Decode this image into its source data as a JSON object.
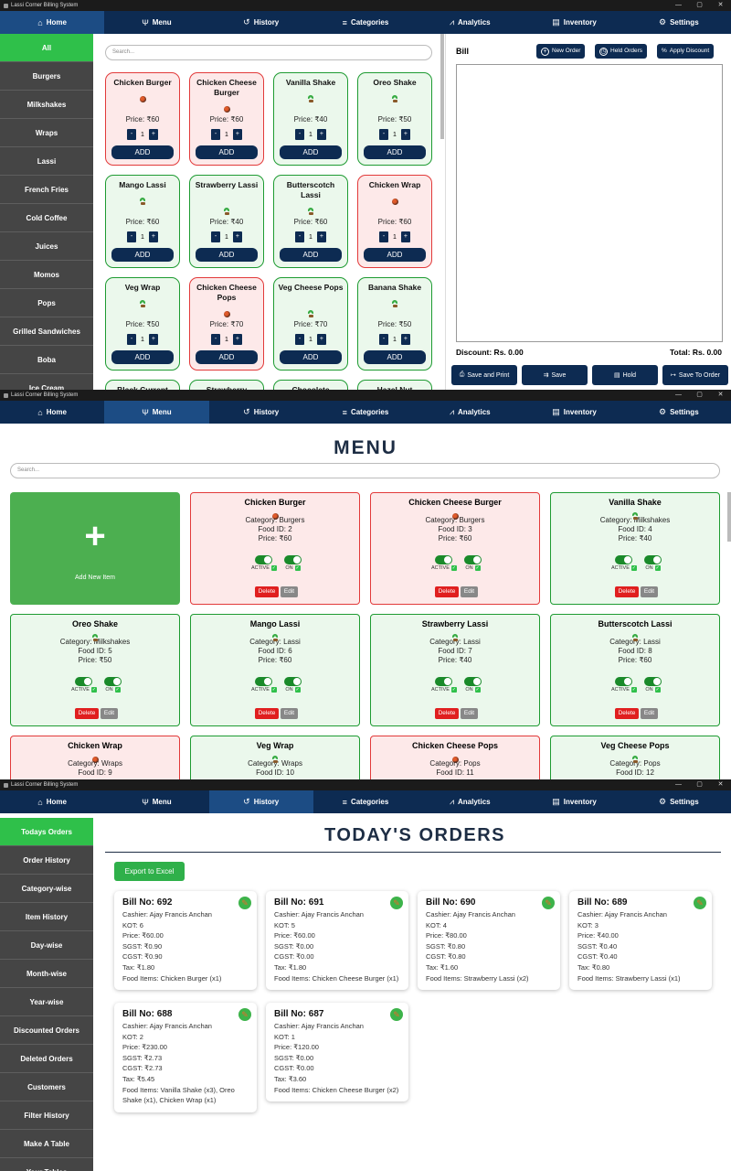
{
  "app_title": "Lassi Corner Billing System",
  "window_controls": [
    "—",
    "▢",
    "✕"
  ],
  "nav": [
    {
      "label": "Home",
      "icon": "home-icon"
    },
    {
      "label": "Menu",
      "icon": "cutlery-icon"
    },
    {
      "label": "History",
      "icon": "history-icon"
    },
    {
      "label": "Categories",
      "icon": "list-icon"
    },
    {
      "label": "Analytics",
      "icon": "chart-icon"
    },
    {
      "label": "Inventory",
      "icon": "inventory-icon"
    },
    {
      "label": "Settings",
      "icon": "gear-icon"
    }
  ],
  "home": {
    "categories": [
      "All",
      "Burgers",
      "Milkshakes",
      "Wraps",
      "Lassi",
      "French Fries",
      "Cold Coffee",
      "Juices",
      "Momos",
      "Pops",
      "Grilled Sandwiches",
      "Boba",
      "Ice Cream"
    ],
    "search_placeholder": "Search...",
    "products": [
      {
        "name": "Chicken Burger",
        "price": "Price: ₹60",
        "veg": false
      },
      {
        "name": "Chicken Cheese Burger",
        "price": "Price: ₹60",
        "veg": false
      },
      {
        "name": "Vanilla Shake",
        "price": "Price: ₹40",
        "veg": true
      },
      {
        "name": "Oreo Shake",
        "price": "Price: ₹50",
        "veg": true
      },
      {
        "name": "Mango Lassi",
        "price": "Price: ₹60",
        "veg": true
      },
      {
        "name": "Strawberry Lassi",
        "price": "Price: ₹40",
        "veg": true
      },
      {
        "name": "Butterscotch Lassi",
        "price": "Price: ₹60",
        "veg": true
      },
      {
        "name": "Chicken Wrap",
        "price": "Price: ₹60",
        "veg": false
      },
      {
        "name": "Veg Wrap",
        "price": "Price: ₹50",
        "veg": true
      },
      {
        "name": "Chicken Cheese Pops",
        "price": "Price: ₹70",
        "veg": false
      },
      {
        "name": "Veg Cheese Pops",
        "price": "Price: ₹70",
        "veg": true
      },
      {
        "name": "Banana Shake",
        "price": "Price: ₹50",
        "veg": true
      }
    ],
    "partial_products": [
      {
        "name": "Black Current",
        "veg": true
      },
      {
        "name": "Strawberry",
        "veg": true
      },
      {
        "name": "Chocolate",
        "veg": true
      },
      {
        "name": "Hazel Nut",
        "veg": true
      }
    ],
    "qty_default": "1",
    "qty_minus": "-",
    "qty_plus": "+",
    "add_label": "ADD",
    "bill": {
      "title": "Bill",
      "new_order": "New Order",
      "held_orders": "Held Orders",
      "apply_discount": "Apply Discount",
      "discount": "Discount: Rs. 0.00",
      "total": "Total: Rs. 0.00",
      "save_print": "Save and Print",
      "save": "Save",
      "hold": "Hold",
      "save_to_order": "Save To Order"
    }
  },
  "menu": {
    "title": "MENU",
    "search_placeholder": "Search...",
    "add_new_label": "Add New Item",
    "add_new_symbol": "+",
    "active_label": "ACTIVE",
    "on_label": "ON",
    "delete_label": "Delete",
    "edit_label": "Edit",
    "items": [
      {
        "name": "Chicken Burger",
        "category": "Category: Burgers",
        "food_id": "Food ID: 2",
        "price": "Price: ₹60",
        "veg": false
      },
      {
        "name": "Chicken Cheese Burger",
        "category": "Category: Burgers",
        "food_id": "Food ID: 3",
        "price": "Price: ₹60",
        "veg": false
      },
      {
        "name": "Vanilla Shake",
        "category": "Category: Milkshakes",
        "food_id": "Food ID: 4",
        "price": "Price: ₹40",
        "veg": true
      },
      {
        "name": "Oreo Shake",
        "category": "Category: Milkshakes",
        "food_id": "Food ID: 5",
        "price": "Price: ₹50",
        "veg": true
      },
      {
        "name": "Mango Lassi",
        "category": "Category: Lassi",
        "food_id": "Food ID: 6",
        "price": "Price: ₹60",
        "veg": true
      },
      {
        "name": "Strawberry Lassi",
        "category": "Category: Lassi",
        "food_id": "Food ID: 7",
        "price": "Price: ₹40",
        "veg": true
      },
      {
        "name": "Butterscotch Lassi",
        "category": "Category: Lassi",
        "food_id": "Food ID: 8",
        "price": "Price: ₹60",
        "veg": true
      },
      {
        "name": "Chicken Wrap",
        "category": "Category: Wraps",
        "food_id": "Food ID: 9",
        "price": "",
        "veg": false
      },
      {
        "name": "Veg Wrap",
        "category": "Category: Wraps",
        "food_id": "Food ID: 10",
        "price": "",
        "veg": true
      },
      {
        "name": "Chicken Cheese Pops",
        "category": "Category: Pops",
        "food_id": "Food ID: 11",
        "price": "",
        "veg": false
      },
      {
        "name": "Veg Cheese Pops",
        "category": "Category: Pops",
        "food_id": "Food ID: 12",
        "price": "",
        "veg": true
      }
    ]
  },
  "history": {
    "sidebar": [
      "Todays Orders",
      "Order History",
      "Category-wise",
      "Item History",
      "Day-wise",
      "Month-wise",
      "Year-wise",
      "Discounted Orders",
      "Deleted Orders",
      "Customers",
      "Filter History",
      "Make A Table",
      "Your Tables"
    ],
    "title": "TODAY'S ORDERS",
    "export_label": "Export to Excel",
    "orders": [
      {
        "bill": "Bill No: 692",
        "cashier": "Cashier: Ajay Francis Anchan",
        "kot": "KOT: 6",
        "price": "Price: ₹60.00",
        "sgst": "SGST: ₹0.90",
        "cgst": "CGST: ₹0.90",
        "tax": "Tax: ₹1.80",
        "items": "Food Items: Chicken Burger (x1)"
      },
      {
        "bill": "Bill No: 691",
        "cashier": "Cashier: Ajay Francis Anchan",
        "kot": "KOT: 5",
        "price": "Price: ₹60.00",
        "sgst": "SGST: ₹0.00",
        "cgst": "CGST: ₹0.00",
        "tax": "Tax: ₹1.80",
        "items": "Food Items: Chicken Cheese Burger (x1)"
      },
      {
        "bill": "Bill No: 690",
        "cashier": "Cashier: Ajay Francis Anchan",
        "kot": "KOT: 4",
        "price": "Price: ₹80.00",
        "sgst": "SGST: ₹0.80",
        "cgst": "CGST: ₹0.80",
        "tax": "Tax: ₹1.60",
        "items": "Food Items: Strawberry Lassi (x2)"
      },
      {
        "bill": "Bill No: 689",
        "cashier": "Cashier: Ajay Francis Anchan",
        "kot": "KOT: 3",
        "price": "Price: ₹40.00",
        "sgst": "SGST: ₹0.40",
        "cgst": "CGST: ₹0.40",
        "tax": "Tax: ₹0.80",
        "items": "Food Items: Strawberry Lassi (x1)"
      },
      {
        "bill": "Bill No: 688",
        "cashier": "Cashier: Ajay Francis Anchan",
        "kot": "KOT: 2",
        "price": "Price: ₹230.00",
        "sgst": "SGST: ₹2.73",
        "cgst": "CGST: ₹2.73",
        "tax": "Tax: ₹5.45",
        "items": "Food Items: Vanilla Shake (x3), Oreo Shake (x1), Chicken Wrap (x1)"
      },
      {
        "bill": "Bill No: 687",
        "cashier": "Cashier: Ajay Francis Anchan",
        "kot": "KOT: 1",
        "price": "Price: ₹120.00",
        "sgst": "SGST: ₹0.00",
        "cgst": "CGST: ₹0.00",
        "tax": "Tax: ₹3.60",
        "items": "Food Items: Chicken Cheese Burger (x2)"
      }
    ]
  },
  "colors": {
    "nav": "#0d2b52",
    "nav_active": "#1c4c84",
    "accent_green": "#2fc04a",
    "veg_border": "#1e9b32",
    "nonveg_border": "#e23a3a",
    "delete": "#e01f1f"
  }
}
